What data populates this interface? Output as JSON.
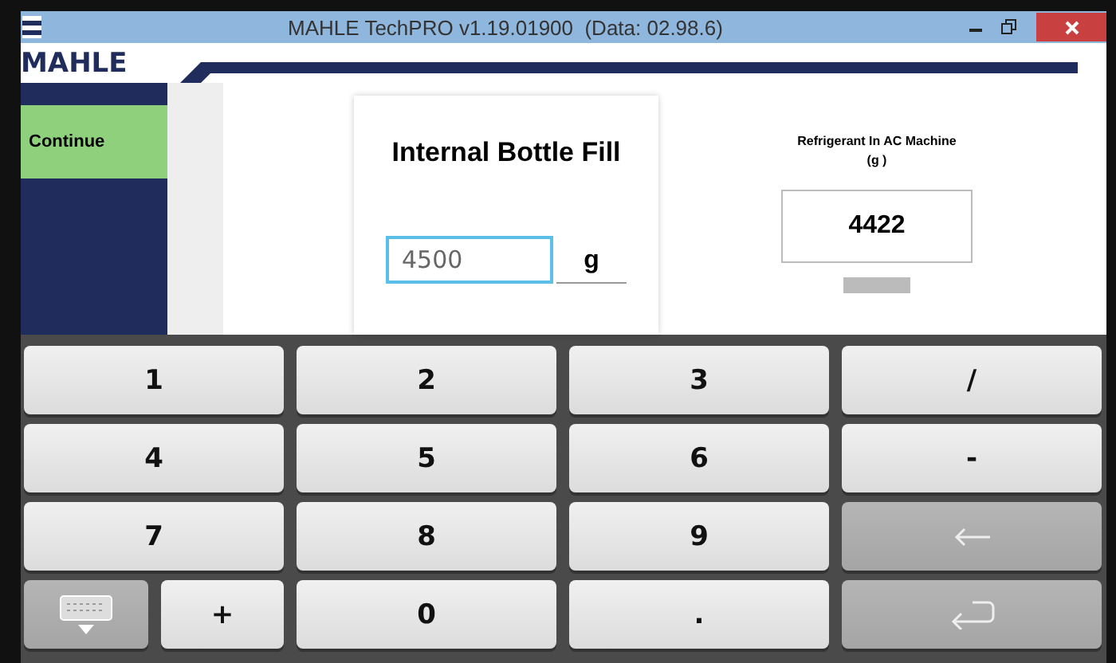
{
  "window": {
    "title": "MAHLE TechPRO v1.19.01900  (Data: 02.98.6)"
  },
  "header": {
    "logo": "MAHLE"
  },
  "sidebar": {
    "button": "Continue"
  },
  "card": {
    "title": "Internal Bottle Fill",
    "value": "4500",
    "unit": "g"
  },
  "reading": {
    "label": "Refrigerant In AC Machine",
    "unit": "(g )",
    "value": "4422"
  },
  "keyboard": [
    {
      "kind": "char",
      "label": "1"
    },
    {
      "kind": "char",
      "label": "2"
    },
    {
      "kind": "char",
      "label": "3"
    },
    {
      "kind": "char",
      "label": "/"
    },
    {
      "kind": "char",
      "label": "4"
    },
    {
      "kind": "char",
      "label": "5"
    },
    {
      "kind": "char",
      "label": "6"
    },
    {
      "kind": "char",
      "label": "-"
    },
    {
      "kind": "char",
      "label": "7"
    },
    {
      "kind": "char",
      "label": "8"
    },
    {
      "kind": "char",
      "label": "9"
    },
    {
      "kind": "backspace"
    },
    {
      "kind": "hide"
    },
    {
      "kind": "small",
      "label": "+"
    },
    {
      "kind": "char",
      "label": "0"
    },
    {
      "kind": "char",
      "label": "."
    },
    {
      "kind": "enter"
    }
  ]
}
